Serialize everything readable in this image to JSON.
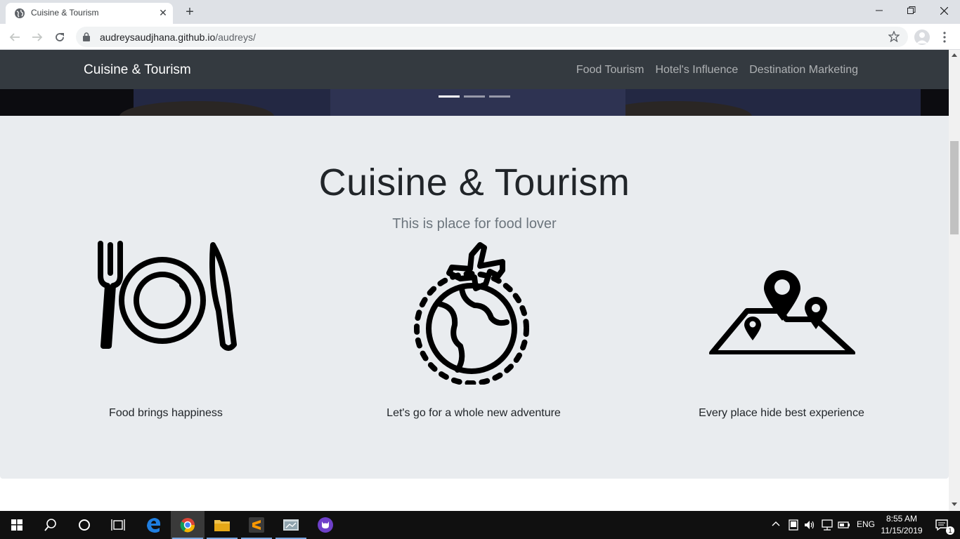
{
  "browser": {
    "tab_title": "Cuisine & Tourism",
    "url_host": "audreysaudjhana.github.io",
    "url_path": "/audreys/"
  },
  "site": {
    "brand": "Cuisine & Tourism",
    "nav": [
      "Food Tourism",
      "Hotel's Influence",
      "Destination Marketing"
    ],
    "carousel_active_index": 0,
    "carousel_count": 3
  },
  "jumbotron": {
    "heading": "Cuisine & Tourism",
    "lead": "This is place for food lover"
  },
  "features": [
    {
      "icon": "dining-plate-icon",
      "caption": "Food brings happiness"
    },
    {
      "icon": "globe-airplane-icon",
      "caption": "Let's go for a whole new adventure"
    },
    {
      "icon": "map-pins-icon",
      "caption": "Every place hide best experience"
    }
  ],
  "taskbar": {
    "lang": "ENG",
    "time": "8:55 AM",
    "date": "11/15/2019",
    "notifications": "1"
  }
}
